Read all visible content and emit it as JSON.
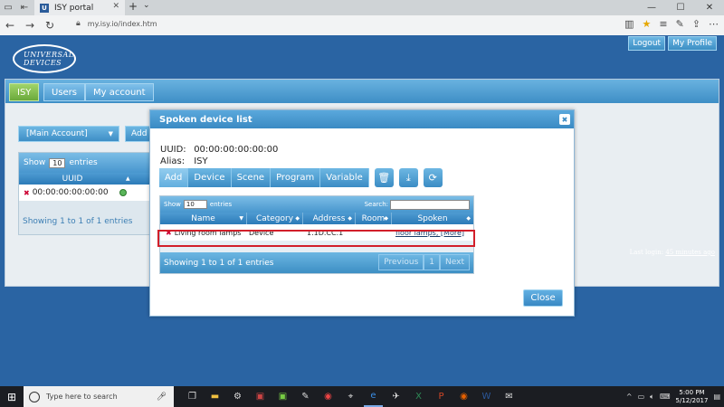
{
  "browser": {
    "tab_title": "ISY portal",
    "url": "my.isy.io/index.htm"
  },
  "page": {
    "logo_line1": "UNIVERSAL",
    "logo_line2": "DEVICES",
    "logout": "Logout",
    "my_profile": "My Profile",
    "tabs": [
      {
        "label": "ISY"
      },
      {
        "label": "Users"
      },
      {
        "label": "My account"
      }
    ],
    "account_select": "[Main Account]",
    "add_label": "Add",
    "uuid_table": {
      "show": "Show",
      "page_size": "10",
      "entries": "entries",
      "col_uuid": "UUID",
      "row_uuid": "00:00:00:00:00:00",
      "footer": "Showing 1 to 1 of 1 entries"
    },
    "last_login_label": "Last login:",
    "last_login_value": "45 minutes ago"
  },
  "modal": {
    "title": "Spoken device list",
    "uuid_label": "UUID:",
    "uuid_value": "00:00:00:00:00:00",
    "alias_label": "Alias:",
    "alias_value": "ISY",
    "actions": [
      {
        "label": "Add"
      },
      {
        "label": "Device"
      },
      {
        "label": "Scene"
      },
      {
        "label": "Program"
      },
      {
        "label": "Variable"
      }
    ],
    "table": {
      "show": "Show",
      "page_size": "10",
      "entries": "entries",
      "search_label": "Search:",
      "columns": [
        "Name",
        "Category",
        "Address",
        "Room",
        "Spoken"
      ],
      "rows": [
        {
          "name": "Living room lamps",
          "category": "Device",
          "address": "1.1D.CC.1",
          "room": "",
          "spoken": "floor lamps, [More]"
        }
      ],
      "footer": "Showing 1 to 1 of 1 entries",
      "prev": "Previous",
      "page": "1",
      "next": "Next"
    },
    "close": "Close"
  },
  "taskbar": {
    "search_placeholder": "Type here to search",
    "time": "5:00 PM",
    "date": "5/12/2017"
  }
}
